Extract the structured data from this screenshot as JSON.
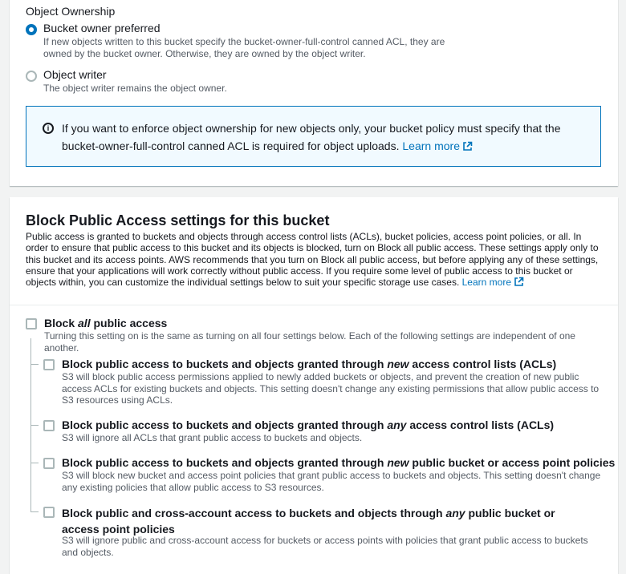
{
  "ownership": {
    "heading": "Object Ownership",
    "options": [
      {
        "title": "Bucket owner preferred",
        "selected": true,
        "description": "If new objects written to this bucket specify the bucket-owner-full-control canned ACL, they are owned by the bucket owner. Otherwise, they are owned by the object writer."
      },
      {
        "title": "Object writer",
        "selected": false,
        "description": "The object writer remains the object owner."
      }
    ],
    "info": {
      "icon": "info-icon",
      "text": "If you want to enforce object ownership for new objects only, your bucket policy must specify that the bucket-owner-full-control canned ACL is required for object uploads.",
      "link": "Learn more",
      "link_icon": "external-link-icon"
    }
  },
  "bpa": {
    "title": "Block Public Access settings for this bucket",
    "intro": "Public access is granted to buckets and objects through access control lists (ACLs), bucket policies, access point policies, or all. In order to ensure that public access to this bucket and its objects is blocked, turn on Block all public access. These settings apply only to this bucket and its access points. AWS recommends that you turn on Block all public access, but before applying any of these settings, ensure that your applications will work correctly without public access. If you require some level of public access to this bucket or objects within, you can customize the individual settings below to suit your specific storage use cases.",
    "intro_link": "Learn more",
    "block_all": {
      "title_pre": "Block ",
      "title_em": "all",
      "title_post": " public access",
      "checked": false,
      "description": "Turning this setting on is the same as turning on all four settings below. Each of the following settings are independent of one another."
    },
    "settings": [
      {
        "title_pre": "Block public access to buckets and objects granted through ",
        "title_em": "new",
        "title_post": " access control lists (ACLs)",
        "checked": false,
        "description": "S3 will block public access permissions applied to newly added buckets or objects, and prevent the creation of new public access ACLs for existing buckets and objects. This setting doesn't change any existing permissions that allow public access to S3 resources using ACLs."
      },
      {
        "title_pre": "Block public access to buckets and objects granted through ",
        "title_em": "any",
        "title_post": " access control lists (ACLs)",
        "checked": false,
        "description": "S3 will ignore all ACLs that grant public access to buckets and objects."
      },
      {
        "title_pre": "Block public access to buckets and objects granted through ",
        "title_em": "new",
        "title_post": " public bucket or access point policies",
        "checked": false,
        "description": "S3 will block new bucket and access point policies that grant public access to buckets and objects. This setting doesn't change any existing policies that allow public access to S3 resources."
      },
      {
        "title_pre": "Block public and cross-account access to buckets and objects through ",
        "title_em": "any",
        "title_post": " public bucket or access point policies",
        "checked": false,
        "description": "S3 will ignore public and cross-account access for buckets or access points with policies that grant public access to buckets and objects."
      }
    ]
  },
  "colors": {
    "accent": "#0073bb",
    "text": "#16191f",
    "secondary_text": "#545b64",
    "info_background": "#f1faff"
  }
}
